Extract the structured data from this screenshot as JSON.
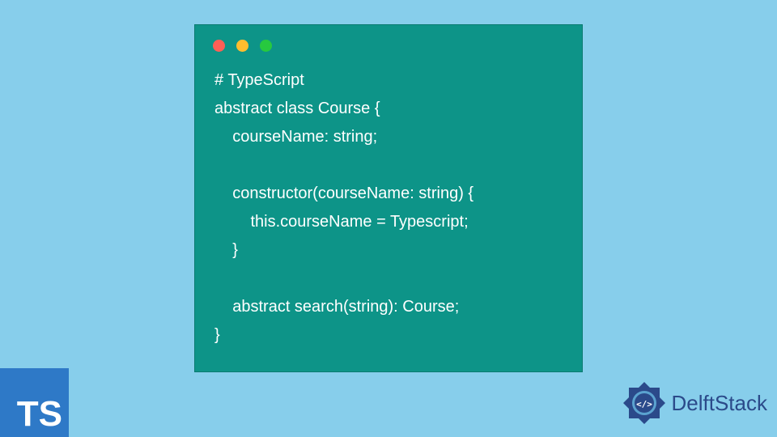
{
  "code": {
    "lines": [
      "# TypeScript",
      "abstract class Course {",
      "    courseName: string;",
      "",
      "    constructor(courseName: string) {",
      "        this.courseName = Typescript;",
      "    }",
      "",
      "    abstract search(string): Course;",
      "}"
    ]
  },
  "badges": {
    "ts": "TS",
    "delft": "DelftStack"
  },
  "colors": {
    "background": "#87ceeb",
    "codeWindow": "#0d9488",
    "tsBadge": "#2e79c7",
    "delftBlue": "#2b4a8a"
  }
}
